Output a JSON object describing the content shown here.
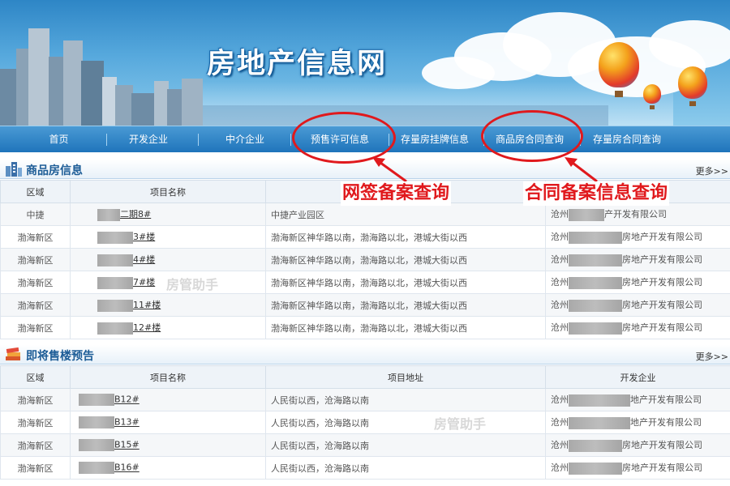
{
  "site": {
    "title": "房地产信息网"
  },
  "nav": {
    "items": [
      {
        "label": "首页"
      },
      {
        "label": "开发企业"
      },
      {
        "label": "中介企业"
      },
      {
        "label": "预售许可信息"
      },
      {
        "label": "存量房挂牌信息"
      },
      {
        "label": "商品房合同查询"
      },
      {
        "label": "存量房合同查询"
      }
    ]
  },
  "section1": {
    "title": "商品房信息",
    "more": "更多>>",
    "columns": [
      "区域",
      "项目名称",
      "",
      ""
    ],
    "rows": [
      {
        "area": "中捷",
        "name": "二期8#",
        "address": "中捷产业园区",
        "dev_prefix": "沧州",
        "dev_suffix": "产开发有限公司"
      },
      {
        "area": "渤海新区",
        "name": "3#楼",
        "address": "渤海新区神华路以南，渤海路以北，港城大街以西",
        "dev_prefix": "沧州",
        "dev_suffix": "房地产开发有限公司"
      },
      {
        "area": "渤海新区",
        "name": "4#楼",
        "address": "渤海新区神华路以南，渤海路以北，港城大街以西",
        "dev_prefix": "沧州",
        "dev_suffix": "房地产开发有限公司"
      },
      {
        "area": "渤海新区",
        "name": "7#楼",
        "address": "渤海新区神华路以南，渤海路以北，港城大街以西",
        "dev_prefix": "沧州",
        "dev_suffix": "房地产开发有限公司"
      },
      {
        "area": "渤海新区",
        "name": "11#楼",
        "address": "渤海新区神华路以南，渤海路以北，港城大街以西",
        "dev_prefix": "沧州",
        "dev_suffix": "房地产开发有限公司"
      },
      {
        "area": "渤海新区",
        "name": "12#楼",
        "address": "渤海新区神华路以南，渤海路以北，港城大街以西",
        "dev_prefix": "沧州",
        "dev_suffix": "房地产开发有限公司"
      }
    ]
  },
  "section2": {
    "title": "即将售楼预告",
    "more": "更多>>",
    "columns": [
      "区域",
      "项目名称",
      "项目地址",
      "开发企业"
    ],
    "rows": [
      {
        "area": "渤海新区",
        "name": "B12#",
        "address": "人民街以西，沧海路以南",
        "dev_prefix": "沧州",
        "dev_suffix": "地产开发有限公司"
      },
      {
        "area": "渤海新区",
        "name": "B13#",
        "address": "人民街以西，沧海路以南",
        "dev_prefix": "沧州",
        "dev_suffix": "地产开发有限公司"
      },
      {
        "area": "渤海新区",
        "name": "B15#",
        "address": "人民街以西，沧海路以南",
        "dev_prefix": "沧州",
        "dev_suffix": "房地产开发有限公司"
      },
      {
        "area": "渤海新区",
        "name": "B16#",
        "address": "人民街以西，沧海路以南",
        "dev_prefix": "沧州",
        "dev_suffix": "房地产开发有限公司"
      }
    ]
  },
  "annotations": {
    "label1": "网签备案查询",
    "label2": "合同备案信息查询",
    "color": "#e0191d"
  },
  "watermark": "房管助手"
}
